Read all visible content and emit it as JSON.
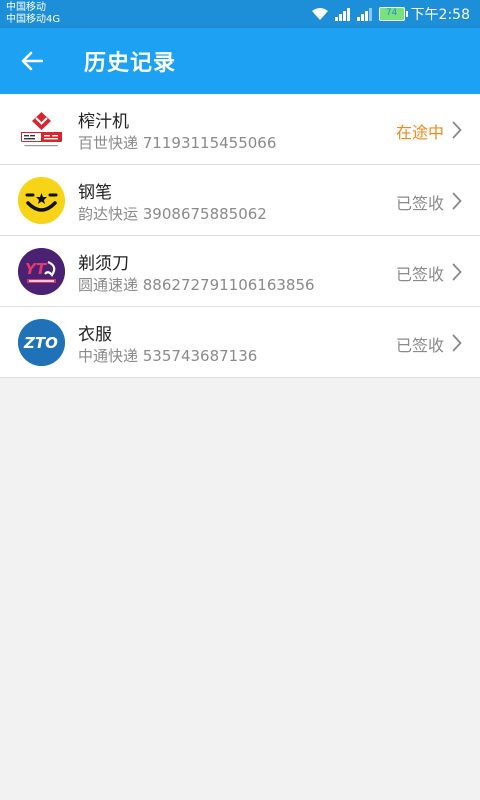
{
  "status_bar": {
    "carrier1": "中国移动",
    "carrier2": "中国移动4G",
    "battery": "74",
    "time": "下午2:58"
  },
  "app_bar": {
    "title": "历史记录",
    "back_icon": "arrow-left-icon"
  },
  "items": [
    {
      "name": "榨汁机",
      "company": "百世快递",
      "tracking": "71193115455066",
      "subtitle": "百世快递 71193115455066",
      "status": "在途中",
      "status_color": "#f08a1b",
      "logo": "best-express-logo",
      "logo_text": "百世快递"
    },
    {
      "name": "钢笔",
      "company": "韵达快运",
      "tracking": "3908675885062",
      "subtitle": "韵达快运 3908675885062",
      "status": "已签收",
      "status_color": "#8a8a8a",
      "logo": "yunda-logo"
    },
    {
      "name": "剃须刀",
      "company": "圆通速递",
      "tracking": "886272791106163856",
      "subtitle": "圆通速递 886272791106163856",
      "status": "已签收",
      "status_color": "#8a8a8a",
      "logo": "yto-logo",
      "logo_text": "YTO"
    },
    {
      "name": "衣服",
      "company": "中通快递",
      "tracking": "535743687136",
      "subtitle": "中通快递 535743687136",
      "status": "已签收",
      "status_color": "#8a8a8a",
      "logo": "zto-logo",
      "logo_text": "ZTO"
    }
  ],
  "colors": {
    "app_bar": "#1da1f2",
    "status_bar": "#1d8ed8",
    "background": "#f2f2f2"
  }
}
